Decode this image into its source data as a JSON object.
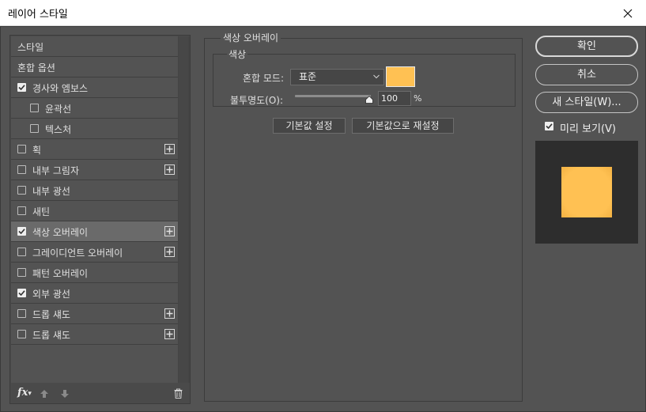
{
  "window": {
    "title": "레이어 스타일"
  },
  "styles_list": [
    {
      "label": "스타일",
      "checkbox": false,
      "checked": false,
      "indent": false,
      "plus": false,
      "selected": false
    },
    {
      "label": "혼합 옵션",
      "checkbox": false,
      "checked": false,
      "indent": false,
      "plus": false,
      "selected": false
    },
    {
      "label": "경사와 엠보스",
      "checkbox": true,
      "checked": true,
      "indent": false,
      "plus": false,
      "selected": false
    },
    {
      "label": "윤곽선",
      "checkbox": true,
      "checked": false,
      "indent": true,
      "plus": false,
      "selected": false
    },
    {
      "label": "텍스처",
      "checkbox": true,
      "checked": false,
      "indent": true,
      "plus": false,
      "selected": false
    },
    {
      "label": "획",
      "checkbox": true,
      "checked": false,
      "indent": false,
      "plus": true,
      "selected": false
    },
    {
      "label": "내부 그림자",
      "checkbox": true,
      "checked": false,
      "indent": false,
      "plus": true,
      "selected": false
    },
    {
      "label": "내부 광선",
      "checkbox": true,
      "checked": false,
      "indent": false,
      "plus": false,
      "selected": false
    },
    {
      "label": "새틴",
      "checkbox": true,
      "checked": false,
      "indent": false,
      "plus": false,
      "selected": false
    },
    {
      "label": "색상 오버레이",
      "checkbox": true,
      "checked": true,
      "indent": false,
      "plus": true,
      "selected": true
    },
    {
      "label": "그레이디언트 오버레이",
      "checkbox": true,
      "checked": false,
      "indent": false,
      "plus": true,
      "selected": false
    },
    {
      "label": "패턴 오버레이",
      "checkbox": true,
      "checked": false,
      "indent": false,
      "plus": false,
      "selected": false
    },
    {
      "label": "외부 광선",
      "checkbox": true,
      "checked": true,
      "indent": false,
      "plus": false,
      "selected": false
    },
    {
      "label": "드롭 섀도",
      "checkbox": true,
      "checked": false,
      "indent": false,
      "plus": true,
      "selected": false
    },
    {
      "label": "드롭 섀도",
      "checkbox": true,
      "checked": false,
      "indent": false,
      "plus": true,
      "selected": false
    }
  ],
  "left_toolbar": {
    "fx_label": "fx"
  },
  "color_overlay": {
    "section_title": "색상 오버레이",
    "group_title": "색상",
    "blend_mode_label": "혼합 모드:",
    "blend_mode_value": "표준",
    "color": "#FFC153",
    "opacity_label": "불투명도(O):",
    "opacity_value": "100",
    "opacity_fraction": 1.0,
    "opacity_unit": "%",
    "make_default_label": "기본값 설정",
    "reset_default_label": "기본값으로 재설정"
  },
  "actions": {
    "ok_label": "확인",
    "cancel_label": "취소",
    "new_style_label": "새 스타일(W)...",
    "preview_label": "미리 보기(V)",
    "preview_checked": true
  }
}
